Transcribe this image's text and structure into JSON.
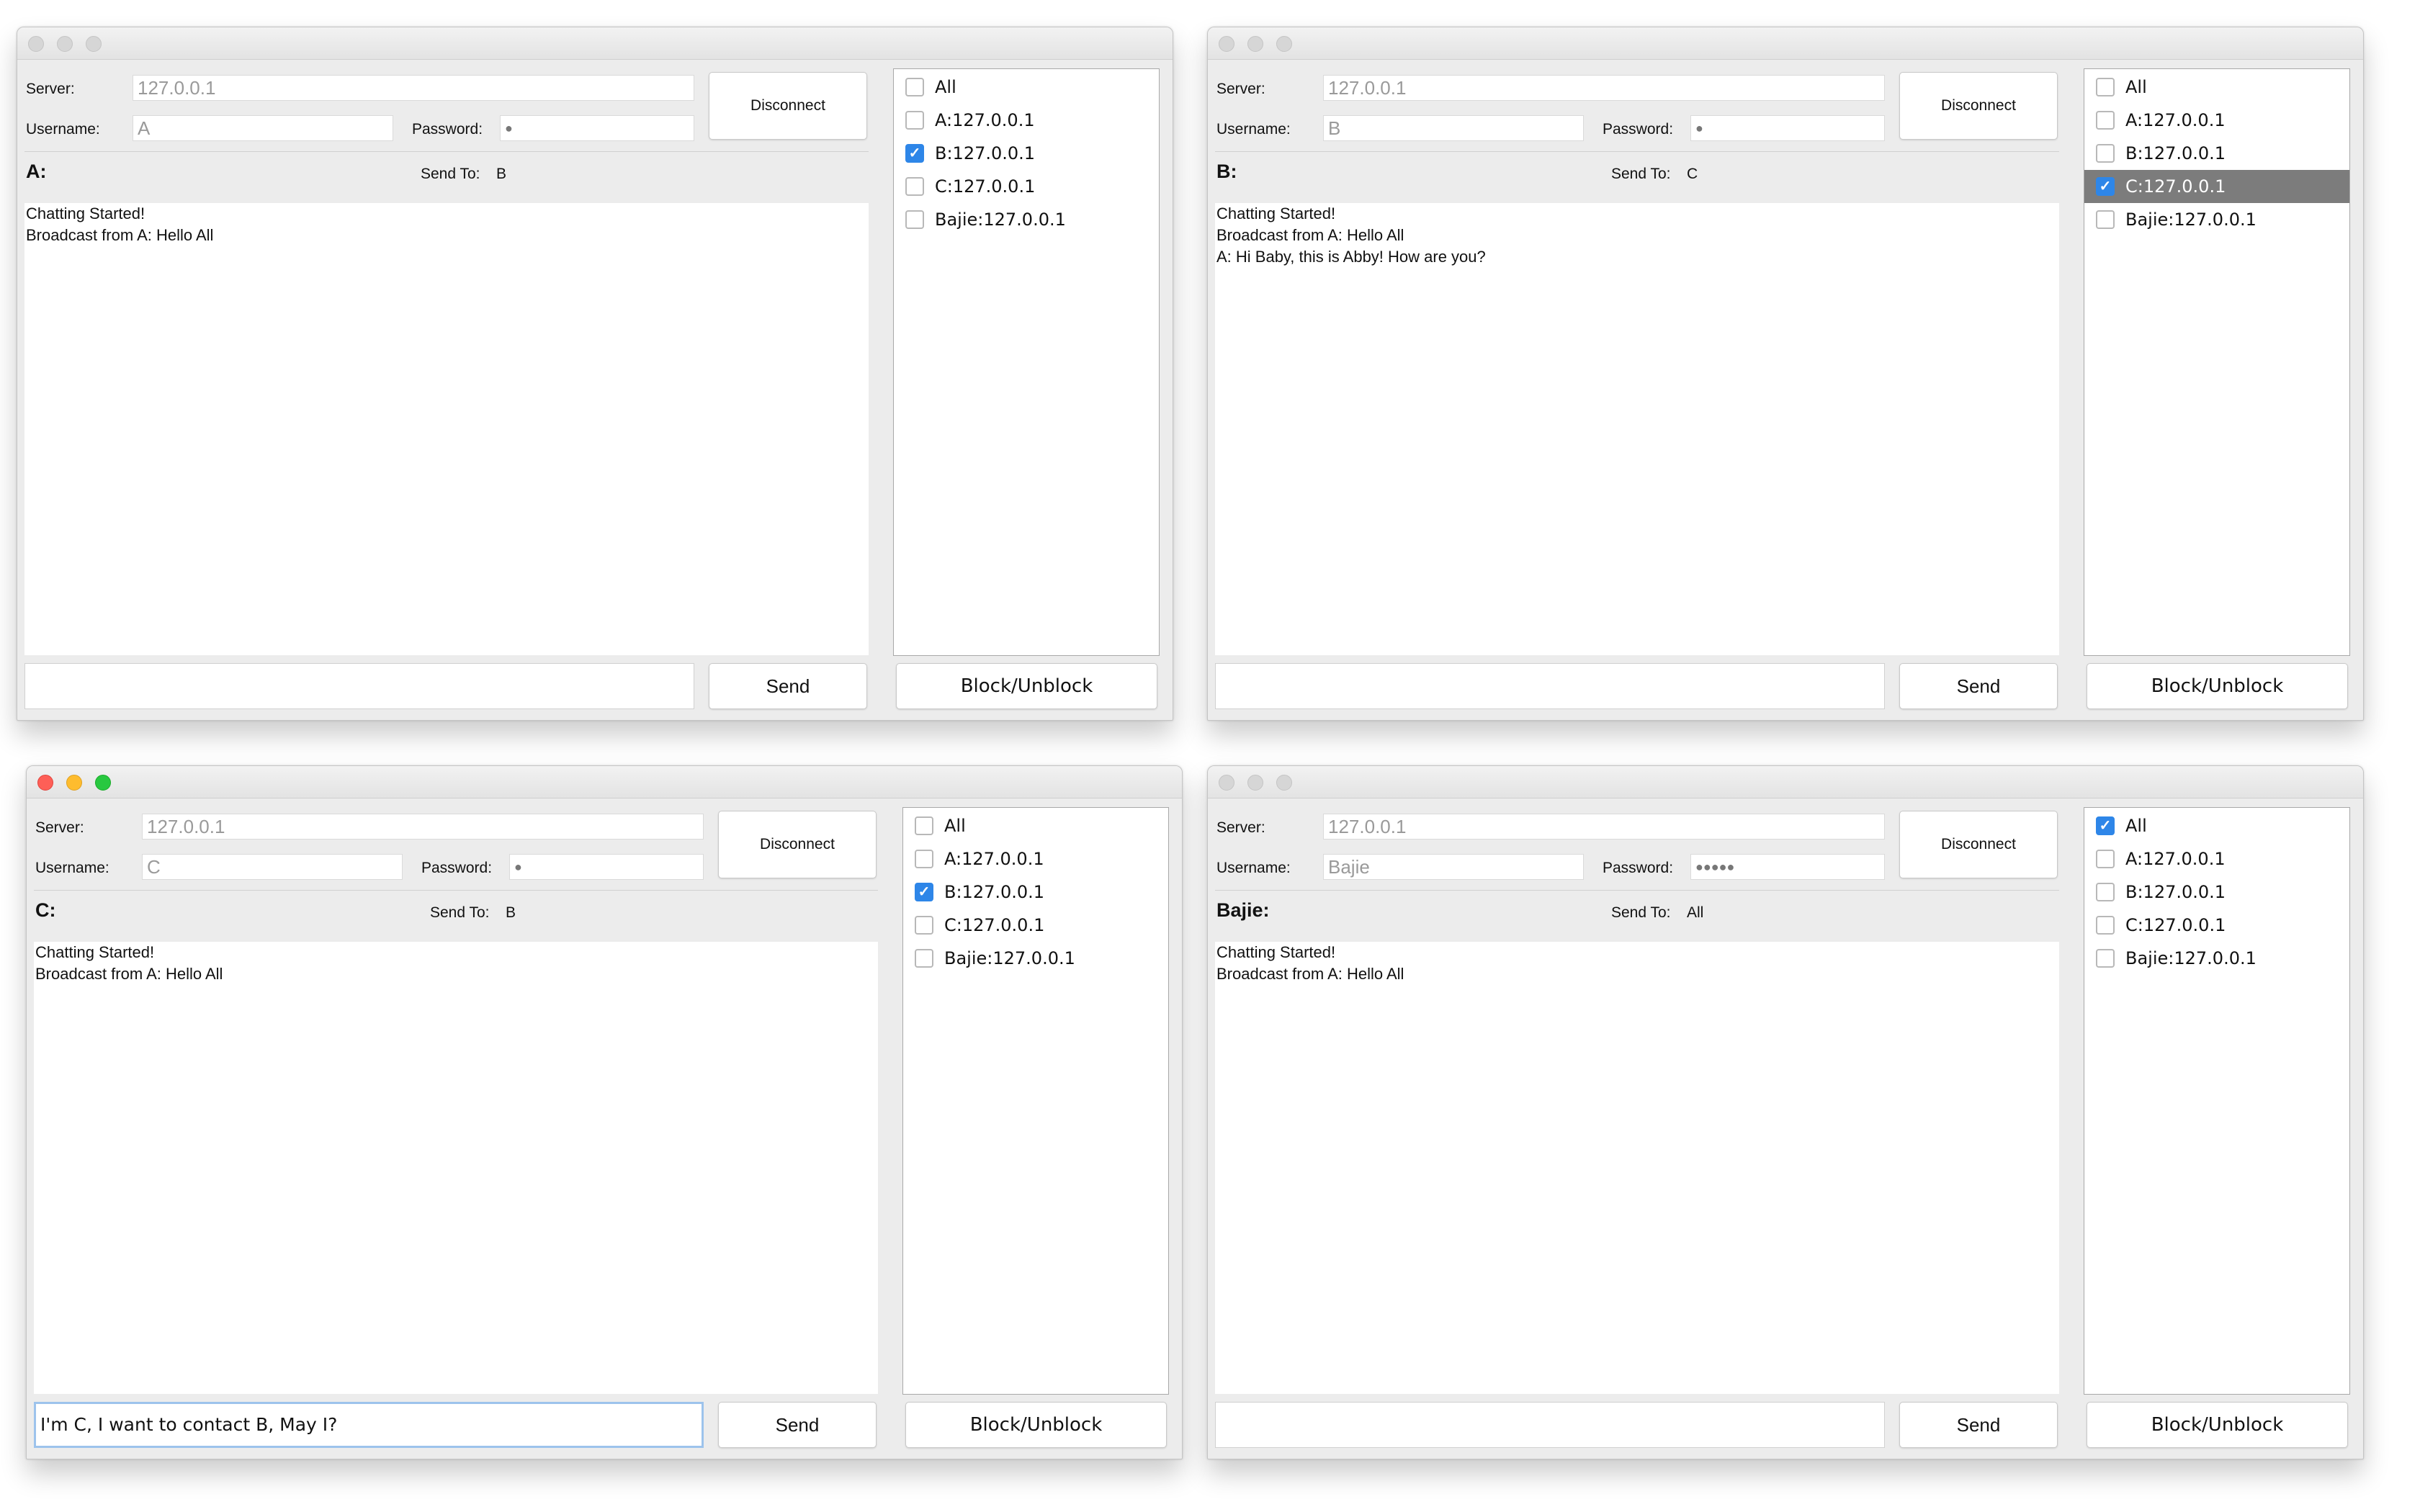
{
  "labels": {
    "server": "Server:",
    "username": "Username:",
    "password": "Password:",
    "send_to": "Send To:",
    "disconnect": "Disconnect",
    "send": "Send",
    "block": "Block/Unblock"
  },
  "colors": {
    "checkbox_checked": "#2e86e8",
    "selected_row": "#7c7c7c",
    "close": "#fe5f57",
    "minimize": "#febc2e",
    "zoom": "#28c840",
    "focus_ring": "#9dc3ec"
  },
  "windows": [
    {
      "id": "a",
      "server": "127.0.0.1",
      "username": "A",
      "password": "●",
      "user_heading": "A:",
      "send_to": "B",
      "messages": [
        "Chatting Started!",
        "Broadcast from A: Hello All"
      ],
      "input": "",
      "users": [
        {
          "label": "All",
          "checked": false
        },
        {
          "label": "A:127.0.0.1",
          "checked": false
        },
        {
          "label": "B:127.0.0.1",
          "checked": true
        },
        {
          "label": "C:127.0.0.1",
          "checked": false
        },
        {
          "label": "Bajie:127.0.0.1",
          "checked": false
        }
      ]
    },
    {
      "id": "b",
      "server": "127.0.0.1",
      "username": "B",
      "password": "●",
      "user_heading": "B:",
      "send_to": "C",
      "messages": [
        "Chatting Started!",
        "Broadcast from A: Hello All",
        "A: Hi Baby, this is Abby! How are you?"
      ],
      "input": "",
      "users": [
        {
          "label": "All",
          "checked": false
        },
        {
          "label": "A:127.0.0.1",
          "checked": false
        },
        {
          "label": "B:127.0.0.1",
          "checked": false
        },
        {
          "label": "C:127.0.0.1",
          "checked": true,
          "selected": true
        },
        {
          "label": "Bajie:127.0.0.1",
          "checked": false
        }
      ]
    },
    {
      "id": "c",
      "server": "127.0.0.1",
      "username": "C",
      "password": "●",
      "user_heading": "C:",
      "send_to": "B",
      "messages": [
        "Chatting Started!",
        "Broadcast from A: Hello All"
      ],
      "input": "I'm C, I want to contact B, May I?",
      "users": [
        {
          "label": "All",
          "checked": false
        },
        {
          "label": "A:127.0.0.1",
          "checked": false
        },
        {
          "label": "B:127.0.0.1",
          "checked": true
        },
        {
          "label": "C:127.0.0.1",
          "checked": false
        },
        {
          "label": "Bajie:127.0.0.1",
          "checked": false
        }
      ]
    },
    {
      "id": "d",
      "server": "127.0.0.1",
      "username": "Bajie",
      "password": "●●●●●",
      "user_heading": "Bajie:",
      "send_to": "All",
      "messages": [
        "Chatting Started!",
        "Broadcast from A: Hello All"
      ],
      "input": "",
      "users": [
        {
          "label": "All",
          "checked": true
        },
        {
          "label": "A:127.0.0.1",
          "checked": false
        },
        {
          "label": "B:127.0.0.1",
          "checked": false
        },
        {
          "label": "C:127.0.0.1",
          "checked": false
        },
        {
          "label": "Bajie:127.0.0.1",
          "checked": false
        }
      ]
    }
  ]
}
